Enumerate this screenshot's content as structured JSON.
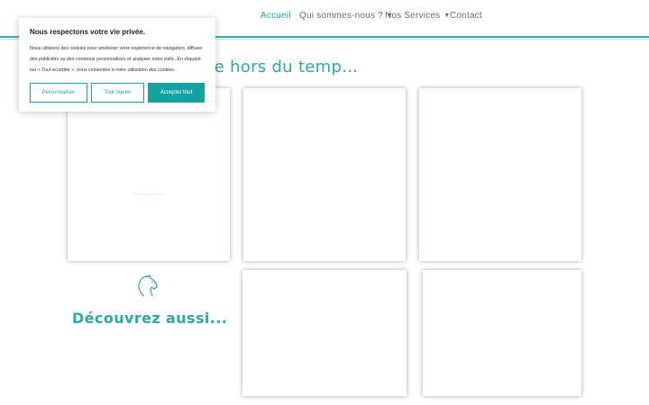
{
  "nav": {
    "items": [
      {
        "label": "Accueil",
        "active": true
      },
      {
        "label": "Qui sommes-nous ?",
        "has_dropdown": true
      },
      {
        "label": "Nos Services",
        "has_dropdown": true
      },
      {
        "label": "Contact"
      }
    ],
    "chevron_icon": "chevron-down-icon"
  },
  "section": {
    "title_partial": "se hors du temp..."
  },
  "discover": {
    "title": "Découvrez aussi...",
    "icon": "horse-head-icon"
  },
  "cookie_banner": {
    "title": "Nous respectons votre vie privée.",
    "text": "Nous utilisons des cookies pour améliorer votre expérience de navigation, diffuser des publicités ou des contenus personnalisés et analyser notre trafic. En cliquant sur « Tout accepter », vous consentez à notre utilisation des cookies.",
    "buttons": {
      "customize": "Personnaliser",
      "reject": "Tout rejeter",
      "accept": "Accepter tout"
    }
  },
  "colors": {
    "accent": "#1aa6a6",
    "accept_button": "#15a3a0",
    "nav_text": "#6b6b6b"
  }
}
